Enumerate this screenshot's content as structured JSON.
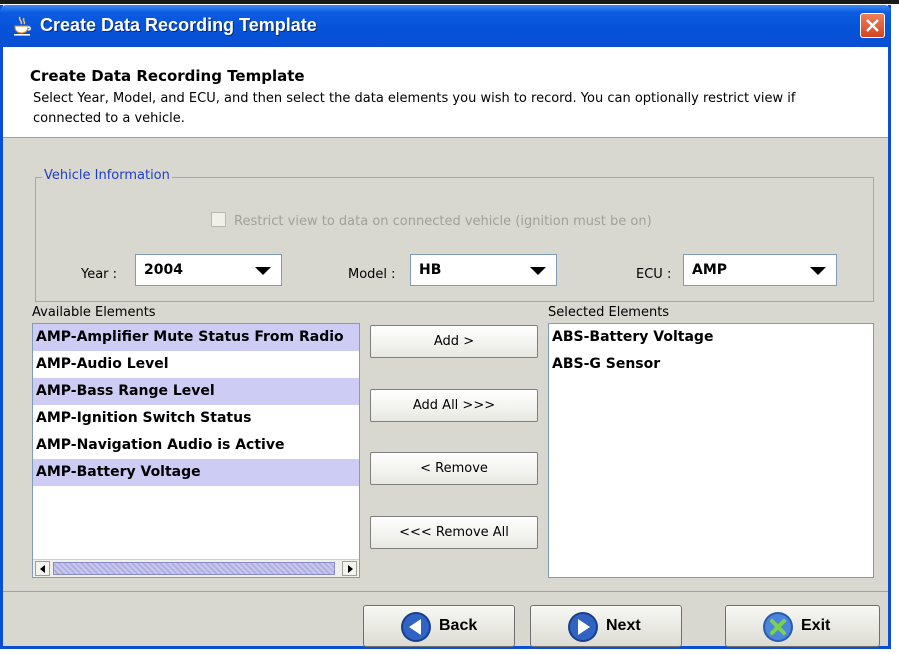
{
  "window": {
    "title": "Create Data Recording Template"
  },
  "header": {
    "title": "Create Data Recording Template",
    "description": "Select Year, Model, and ECU, and then select the data elements you wish to record.  You can optionally restrict view if connected to a vehicle."
  },
  "vehicle_info": {
    "legend": "Vehicle Information",
    "restrict_label": "Restrict view to data on connected vehicle (ignition must be on)",
    "restrict_checked": false,
    "year": {
      "label": "Year :",
      "value": "2004"
    },
    "model": {
      "label": "Model :",
      "value": "HB"
    },
    "ecu": {
      "label": "ECU :",
      "value": "AMP"
    }
  },
  "available": {
    "label": "Available Elements",
    "items": [
      "AMP-Amplifier Mute Status From Radio",
      "AMP-Audio Level",
      "AMP-Bass Range Level",
      "AMP-Ignition Switch Status",
      "AMP-Navigation Audio is Active",
      "AMP-Battery Voltage"
    ]
  },
  "selected": {
    "label": "Selected Elements",
    "items": [
      "ABS-Battery Voltage",
      "ABS-G Sensor"
    ]
  },
  "actions": {
    "add": "Add >",
    "add_all": "Add All >>>",
    "remove": "< Remove",
    "remove_all": "<<< Remove All"
  },
  "nav": {
    "back": "Back",
    "next": "Next",
    "exit": "Exit"
  },
  "colors": {
    "title_bar": "#0a4fd3",
    "selection_band": "#ccccf5",
    "legend_text": "#1f3ec4"
  },
  "icons": {
    "app": "java-cup-icon",
    "close": "close-icon",
    "back": "back-arrow-icon",
    "next": "next-arrow-icon",
    "exit": "exit-x-icon"
  }
}
